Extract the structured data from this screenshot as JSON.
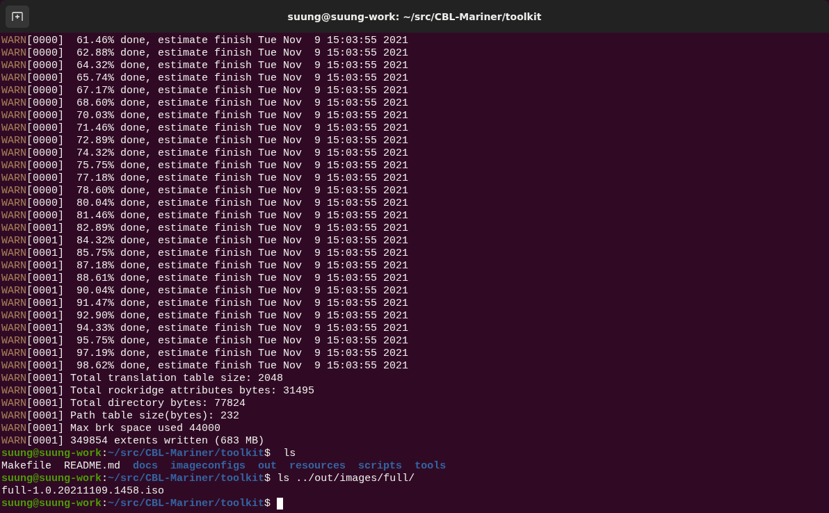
{
  "window": {
    "title": "suung@suung-work: ~/src/CBL-Mariner/toolkit"
  },
  "terminal": {
    "lines": [
      {
        "kind": "warn",
        "label": "WARN",
        "text": "[0000]  61.46% done, estimate finish Tue Nov  9 15:03:55 2021"
      },
      {
        "kind": "warn",
        "label": "WARN",
        "text": "[0000]  62.88% done, estimate finish Tue Nov  9 15:03:55 2021"
      },
      {
        "kind": "warn",
        "label": "WARN",
        "text": "[0000]  64.32% done, estimate finish Tue Nov  9 15:03:55 2021"
      },
      {
        "kind": "warn",
        "label": "WARN",
        "text": "[0000]  65.74% done, estimate finish Tue Nov  9 15:03:55 2021"
      },
      {
        "kind": "warn",
        "label": "WARN",
        "text": "[0000]  67.17% done, estimate finish Tue Nov  9 15:03:55 2021"
      },
      {
        "kind": "warn",
        "label": "WARN",
        "text": "[0000]  68.60% done, estimate finish Tue Nov  9 15:03:55 2021"
      },
      {
        "kind": "warn",
        "label": "WARN",
        "text": "[0000]  70.03% done, estimate finish Tue Nov  9 15:03:55 2021"
      },
      {
        "kind": "warn",
        "label": "WARN",
        "text": "[0000]  71.46% done, estimate finish Tue Nov  9 15:03:55 2021"
      },
      {
        "kind": "warn",
        "label": "WARN",
        "text": "[0000]  72.89% done, estimate finish Tue Nov  9 15:03:55 2021"
      },
      {
        "kind": "warn",
        "label": "WARN",
        "text": "[0000]  74.32% done, estimate finish Tue Nov  9 15:03:55 2021"
      },
      {
        "kind": "warn",
        "label": "WARN",
        "text": "[0000]  75.75% done, estimate finish Tue Nov  9 15:03:55 2021"
      },
      {
        "kind": "warn",
        "label": "WARN",
        "text": "[0000]  77.18% done, estimate finish Tue Nov  9 15:03:55 2021"
      },
      {
        "kind": "warn",
        "label": "WARN",
        "text": "[0000]  78.60% done, estimate finish Tue Nov  9 15:03:55 2021"
      },
      {
        "kind": "warn",
        "label": "WARN",
        "text": "[0000]  80.04% done, estimate finish Tue Nov  9 15:03:55 2021"
      },
      {
        "kind": "warn",
        "label": "WARN",
        "text": "[0000]  81.46% done, estimate finish Tue Nov  9 15:03:55 2021"
      },
      {
        "kind": "warn",
        "label": "WARN",
        "text": "[0001]  82.89% done, estimate finish Tue Nov  9 15:03:55 2021"
      },
      {
        "kind": "warn",
        "label": "WARN",
        "text": "[0001]  84.32% done, estimate finish Tue Nov  9 15:03:55 2021"
      },
      {
        "kind": "warn",
        "label": "WARN",
        "text": "[0001]  85.75% done, estimate finish Tue Nov  9 15:03:55 2021"
      },
      {
        "kind": "warn",
        "label": "WARN",
        "text": "[0001]  87.18% done, estimate finish Tue Nov  9 15:03:55 2021"
      },
      {
        "kind": "warn",
        "label": "WARN",
        "text": "[0001]  88.61% done, estimate finish Tue Nov  9 15:03:55 2021"
      },
      {
        "kind": "warn",
        "label": "WARN",
        "text": "[0001]  90.04% done, estimate finish Tue Nov  9 15:03:55 2021"
      },
      {
        "kind": "warn",
        "label": "WARN",
        "text": "[0001]  91.47% done, estimate finish Tue Nov  9 15:03:55 2021"
      },
      {
        "kind": "warn",
        "label": "WARN",
        "text": "[0001]  92.90% done, estimate finish Tue Nov  9 15:03:55 2021"
      },
      {
        "kind": "warn",
        "label": "WARN",
        "text": "[0001]  94.33% done, estimate finish Tue Nov  9 15:03:55 2021"
      },
      {
        "kind": "warn",
        "label": "WARN",
        "text": "[0001]  95.75% done, estimate finish Tue Nov  9 15:03:55 2021"
      },
      {
        "kind": "warn",
        "label": "WARN",
        "text": "[0001]  97.19% done, estimate finish Tue Nov  9 15:03:55 2021"
      },
      {
        "kind": "warn",
        "label": "WARN",
        "text": "[0001]  98.62% done, estimate finish Tue Nov  9 15:03:55 2021"
      },
      {
        "kind": "warn",
        "label": "WARN",
        "text": "[0001] Total translation table size: 2048"
      },
      {
        "kind": "warn",
        "label": "WARN",
        "text": "[0001] Total rockridge attributes bytes: 31495"
      },
      {
        "kind": "warn",
        "label": "WARN",
        "text": "[0001] Total directory bytes: 77824"
      },
      {
        "kind": "warn",
        "label": "WARN",
        "text": "[0001] Path table size(bytes): 232"
      },
      {
        "kind": "warn",
        "label": "WARN",
        "text": "[0001] Max brk space used 44000"
      },
      {
        "kind": "warn",
        "label": "WARN",
        "text": "[0001] 349854 extents written (683 MB)"
      },
      {
        "kind": "prompt",
        "user_host": "suung@suung-work",
        "separator": ":",
        "path": "~/src/CBL-Mariner/toolkit",
        "symbol": "$",
        "command": " ls"
      },
      {
        "kind": "listing",
        "entries": [
          {
            "name": "Makefile",
            "kind": "file"
          },
          {
            "name": "README.md",
            "kind": "file"
          },
          {
            "name": "docs",
            "kind": "dir"
          },
          {
            "name": "imageconfigs",
            "kind": "dir"
          },
          {
            "name": "out",
            "kind": "dir"
          },
          {
            "name": "resources",
            "kind": "dir"
          },
          {
            "name": "scripts",
            "kind": "dir"
          },
          {
            "name": "tools",
            "kind": "dir"
          }
        ]
      },
      {
        "kind": "prompt",
        "user_host": "suung@suung-work",
        "separator": ":",
        "path": "~/src/CBL-Mariner/toolkit",
        "symbol": "$",
        "command": "ls ../out/images/full/"
      },
      {
        "kind": "output",
        "text": "full-1.0.20211109.1458.iso"
      },
      {
        "kind": "prompt",
        "user_host": "suung@suung-work",
        "separator": ":",
        "path": "~/src/CBL-Mariner/toolkit",
        "symbol": "$",
        "cursor": true
      }
    ]
  }
}
